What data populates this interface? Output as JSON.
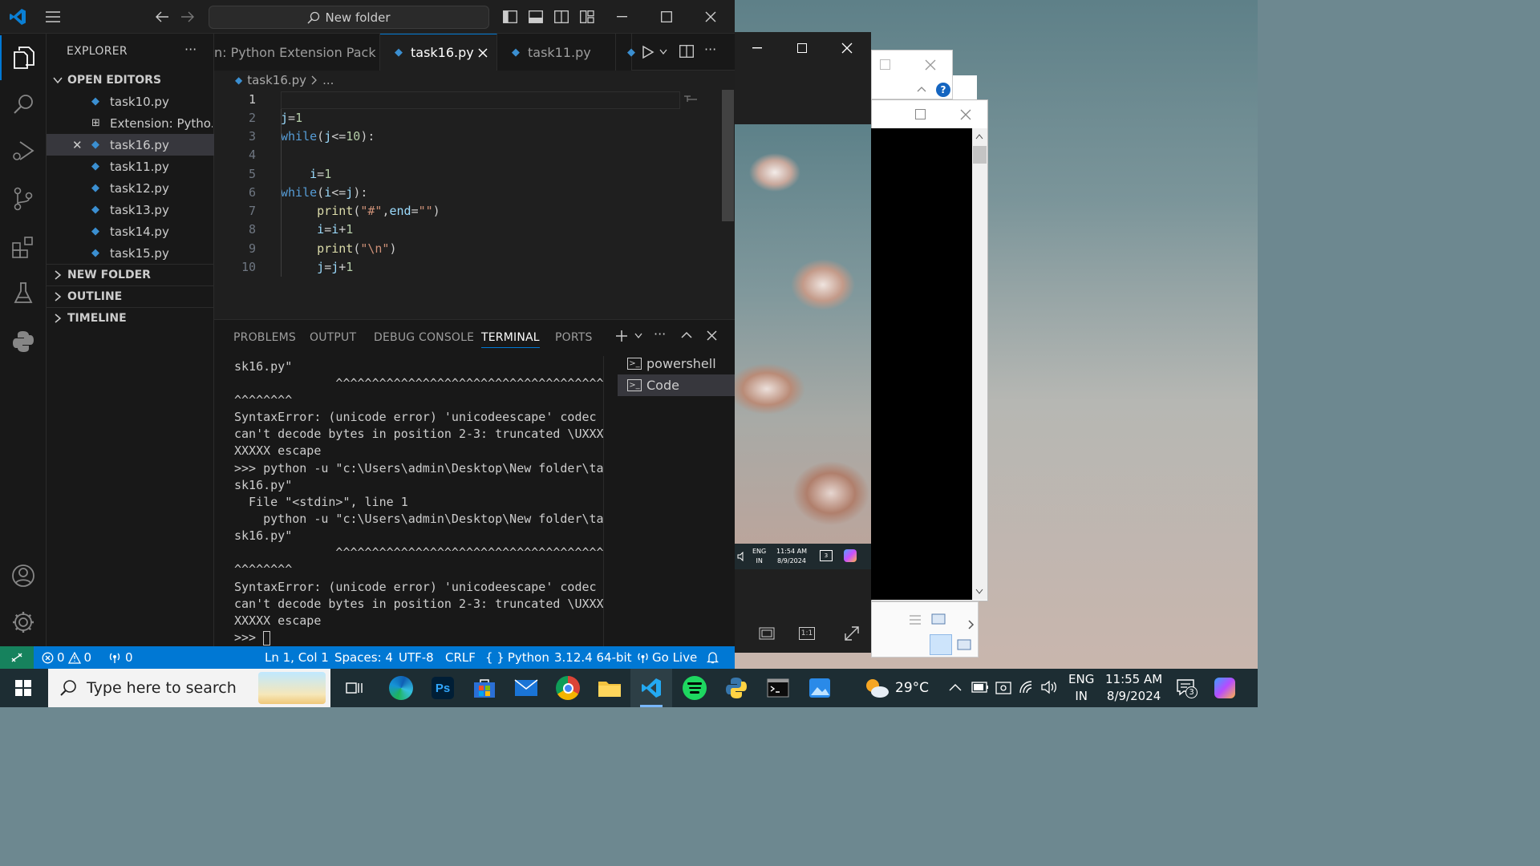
{
  "colors": {
    "accent": "#0078d4",
    "statusbar": "#0078d4",
    "remote": "#16825d",
    "python_icon": "#3b8fd1"
  },
  "titlebar": {
    "search_text": "New folder",
    "icons": [
      "vscode-logo-icon",
      "menu-icon",
      "back-arrow-icon",
      "forward-arrow-icon",
      "toggle-sidebar-icon",
      "toggle-panel-icon",
      "toggle-secondary-sidebar-icon",
      "customize-layout-icon",
      "minimize-icon",
      "maximize-icon",
      "close-icon"
    ]
  },
  "activitybar": {
    "items": [
      "explorer-icon",
      "search-icon",
      "run-debug-icon",
      "source-control-icon",
      "extensions-icon",
      "testing-icon",
      "python-icon"
    ],
    "bottom": [
      "accounts-icon",
      "settings-gear-icon"
    ]
  },
  "sidebar": {
    "title": "EXPLORER",
    "open_editors_label": "OPEN EDITORS",
    "open_editors": [
      {
        "name": "task10.py"
      },
      {
        "name": "Extension: Pytho..."
      },
      {
        "name": "task16.py"
      },
      {
        "name": "task11.py"
      },
      {
        "name": "task12.py"
      },
      {
        "name": "task13.py"
      },
      {
        "name": "task14.py"
      },
      {
        "name": "task15.py"
      }
    ],
    "sections": [
      "NEW FOLDER",
      "OUTLINE",
      "TIMELINE"
    ]
  },
  "tabs": [
    {
      "label": "n: Python Extension Pack"
    },
    {
      "label": "task16.py"
    },
    {
      "label": "task11.py"
    }
  ],
  "breadcrumb": {
    "file": "task16.py",
    "rest": "..."
  },
  "editor": {
    "line_numbers": [
      "1",
      "2",
      "3",
      "4",
      "5",
      "6",
      "7",
      "8",
      "9",
      "10"
    ]
  },
  "panel": {
    "tabs": [
      "PROBLEMS",
      "OUTPUT",
      "DEBUG CONSOLE",
      "TERMINAL",
      "PORTS"
    ],
    "terminal_lines": [
      "sk16.py\"",
      "              ^^^^^^^^^^^^^^^^^^^^^^^^^^^^^^^^^^^^^",
      "^^^^^^^^",
      "SyntaxError: (unicode error) 'unicodeescape' codec",
      "can't decode bytes in position 2-3: truncated \\UXXX",
      "XXXXX escape",
      ">>> python -u \"c:\\Users\\admin\\Desktop\\New folder\\ta",
      "sk16.py\"",
      "  File \"<stdin>\", line 1",
      "    python -u \"c:\\Users\\admin\\Desktop\\New folder\\ta",
      "sk16.py\"",
      "              ^^^^^^^^^^^^^^^^^^^^^^^^^^^^^^^^^^^^^",
      "^^^^^^^^",
      "SyntaxError: (unicode error) 'unicodeescape' codec",
      "can't decode bytes in position 2-3: truncated \\UXXX",
      "XXXXX escape",
      ">>> "
    ],
    "terminals": [
      "powershell",
      "Code"
    ]
  },
  "statusbar": {
    "errors": "0",
    "warnings": "0",
    "ports": "0",
    "position": "Ln 1, Col 1",
    "spaces": "Spaces: 4",
    "encoding": "UTF-8",
    "eol": "CRLF",
    "language": "Python",
    "interpreter": "3.12.4 64-bit",
    "golive": "Go Live"
  },
  "mini_tray": {
    "lang1": "ENG",
    "lang2": "IN",
    "time": "11:54 AM",
    "date": "8/9/2024",
    "badge": "3"
  },
  "taskbar": {
    "search_placeholder": "Type here to search",
    "apps": [
      "task-view-icon",
      "edge-icon",
      "photoshop-icon",
      "store-icon",
      "mail-icon",
      "chrome-icon",
      "file-explorer-icon",
      "vscode-icon",
      "spotify-icon",
      "python-idle-icon",
      "terminal-icon",
      "photos-icon"
    ],
    "weather": "29°C",
    "lang1": "ENG",
    "lang2": "IN",
    "time": "11:55 AM",
    "date": "8/9/2024",
    "notif_count": "3"
  }
}
